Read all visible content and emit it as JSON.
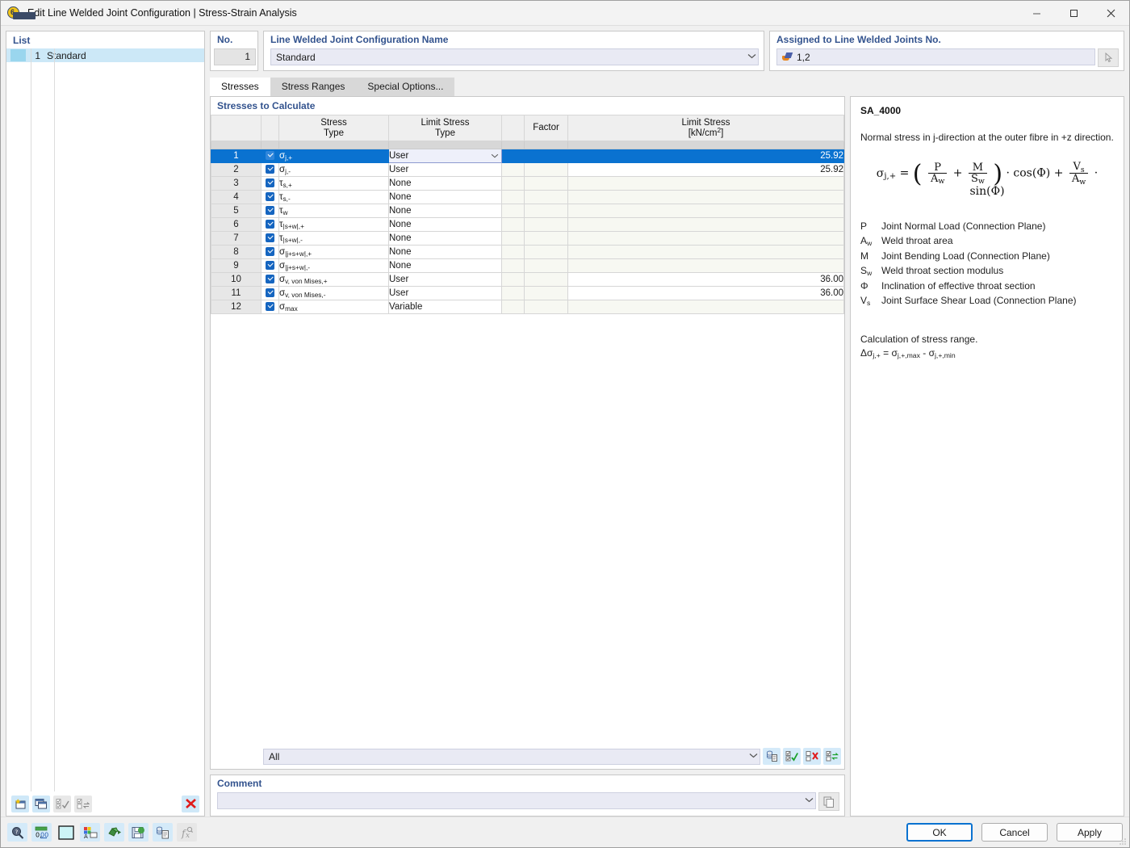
{
  "window": {
    "title": "Edit Line Welded Joint Configuration | Stress-Strain Analysis",
    "icon": "app-icon",
    "minimize": "—",
    "maximize": "□",
    "close": "✕"
  },
  "list_panel": {
    "header": "List",
    "rows": [
      {
        "number": "1",
        "name": "Standard"
      }
    ],
    "toolbar": [
      {
        "name": "new-item-button",
        "enabled": true
      },
      {
        "name": "copy-item-button",
        "enabled": true
      },
      {
        "name": "select-all-button",
        "enabled": false
      },
      {
        "name": "invert-selection-button",
        "enabled": false
      },
      {
        "name": "delete-item-button",
        "enabled": true
      }
    ]
  },
  "number_field": {
    "label": "No.",
    "value": "1"
  },
  "name_field": {
    "label": "Line Welded Joint Configuration Name",
    "value": "Standard"
  },
  "assigned_field": {
    "label": "Assigned to Line Welded Joints No.",
    "value": "1,2"
  },
  "tabs": [
    {
      "label": "Stresses",
      "active": true
    },
    {
      "label": "Stress Ranges",
      "active": false
    },
    {
      "label": "Special Options...",
      "active": false
    }
  ],
  "stress_table": {
    "title": "Stresses to Calculate",
    "columns": [
      {
        "key": "num",
        "header": ""
      },
      {
        "key": "chk",
        "header": ""
      },
      {
        "key": "stress_type",
        "header": "Stress\nType"
      },
      {
        "key": "limit_stress_type",
        "header": "Limit Stress\nType"
      },
      {
        "key": "gap",
        "header": ""
      },
      {
        "key": "factor",
        "header": "Factor"
      },
      {
        "key": "limit_stress",
        "header": "Limit Stress\n[kN/cm2]"
      }
    ],
    "header_stress_type_l1": "Stress",
    "header_stress_type_l2": "Type",
    "header_limit_type_l1": "Limit Stress",
    "header_limit_type_l2": "Type",
    "header_factor": "Factor",
    "header_limit_stress_l1": "Limit Stress",
    "header_limit_stress_l2_pre": "[kN/cm",
    "header_limit_stress_l2_sup": "2",
    "header_limit_stress_l2_post": "]",
    "rows": [
      {
        "num": "1",
        "checked": true,
        "stress_sym": "σ",
        "stress_sub": "j,+",
        "limit_type": "User",
        "factor": "",
        "limit_stress": "25.92",
        "selected": true
      },
      {
        "num": "2",
        "checked": true,
        "stress_sym": "σ",
        "stress_sub": "j,-",
        "limit_type": "User",
        "factor": "",
        "limit_stress": "25.92",
        "selected": false
      },
      {
        "num": "3",
        "checked": true,
        "stress_sym": "τ",
        "stress_sub": "s,+",
        "limit_type": "None",
        "factor": "",
        "limit_stress": "",
        "selected": false
      },
      {
        "num": "4",
        "checked": true,
        "stress_sym": "τ",
        "stress_sub": "s,-",
        "limit_type": "None",
        "factor": "",
        "limit_stress": "",
        "selected": false
      },
      {
        "num": "5",
        "checked": true,
        "stress_sym": "τ",
        "stress_sub": "w",
        "limit_type": "None",
        "factor": "",
        "limit_stress": "",
        "selected": false
      },
      {
        "num": "6",
        "checked": true,
        "stress_sym": "τ",
        "stress_sub": "|s+w|,+",
        "limit_type": "None",
        "factor": "",
        "limit_stress": "",
        "selected": false
      },
      {
        "num": "7",
        "checked": true,
        "stress_sym": "τ",
        "stress_sub": "|s+w|,-",
        "limit_type": "None",
        "factor": "",
        "limit_stress": "",
        "selected": false
      },
      {
        "num": "8",
        "checked": true,
        "stress_sym": "σ",
        "stress_sub": "|j+s+w|,+",
        "limit_type": "None",
        "factor": "",
        "limit_stress": "",
        "selected": false
      },
      {
        "num": "9",
        "checked": true,
        "stress_sym": "σ",
        "stress_sub": "|j+s+w|,-",
        "limit_type": "None",
        "factor": "",
        "limit_stress": "",
        "selected": false
      },
      {
        "num": "10",
        "checked": true,
        "stress_sym": "σ",
        "stress_sub": "v, von Mises,+",
        "limit_type": "User",
        "factor": "",
        "limit_stress": "36.00",
        "selected": false
      },
      {
        "num": "11",
        "checked": true,
        "stress_sym": "σ",
        "stress_sub": "v, von Mises,-",
        "limit_type": "User",
        "factor": "",
        "limit_stress": "36.00",
        "selected": false
      },
      {
        "num": "12",
        "checked": true,
        "stress_sym": "σ",
        "stress_sub": "max",
        "limit_type": "Variable",
        "factor": "",
        "limit_stress": "",
        "selected": false
      }
    ],
    "bottom": {
      "filter_value": "All",
      "buttons": [
        {
          "name": "insert-rows-button"
        },
        {
          "name": "check-all-button"
        },
        {
          "name": "uncheck-all-button"
        },
        {
          "name": "reset-button"
        }
      ]
    }
  },
  "comment": {
    "label": "Comment",
    "value": ""
  },
  "info_panel": {
    "code": "SA_4000",
    "description": "Normal stress in j-direction at the outer fibre in +z direction.",
    "formula": {
      "lhs_sym": "σ",
      "lhs_sub": "j,+",
      "eq": "=",
      "frac1_n": "P",
      "frac1_d_sym": "A",
      "frac1_d_sub": "w",
      "plus": "+",
      "frac2_n": "M",
      "frac2_d_sym": "S",
      "frac2_d_sub": "w",
      "cos": "· cos(Φ) +",
      "frac3_n_sym": "V",
      "frac3_n_sub": "s",
      "frac3_d_sym": "A",
      "frac3_d_sub": "w",
      "sin": "· sin(Φ)"
    },
    "symbols": [
      {
        "sym": "P",
        "sub": "",
        "desc": "Joint Normal Load (Connection Plane)"
      },
      {
        "sym": "A",
        "sub": "w",
        "desc": "Weld throat area"
      },
      {
        "sym": "M",
        "sub": "",
        "desc": "Joint Bending Load (Connection Plane)"
      },
      {
        "sym": "S",
        "sub": "w",
        "desc": "Weld throat section modulus"
      },
      {
        "sym": "Φ",
        "sub": "",
        "desc": "Inclination of effective throat section"
      },
      {
        "sym": "V",
        "sub": "s",
        "desc": "Joint Surface Shear Load (Connection Plane)"
      }
    ],
    "range_title": "Calculation of stress range.",
    "range_formula_delta": "Δσ",
    "range_formula_sub1": "j,+",
    "range_formula_eq": " = ",
    "range_formula_sym2": "σ",
    "range_formula_sub2": "j,+,max",
    "range_formula_minus": " - ",
    "range_formula_sym3": "σ",
    "range_formula_sub3": "j,+,min"
  },
  "bottom_bar": {
    "tools": [
      {
        "name": "info-search-icon",
        "enabled": true
      },
      {
        "name": "decimal-places-icon",
        "enabled": true
      },
      {
        "name": "color-swatch-icon",
        "enabled": true
      },
      {
        "name": "display-properties-icon",
        "enabled": true
      },
      {
        "name": "render-icon",
        "enabled": true
      },
      {
        "name": "save-as-icon",
        "enabled": true
      },
      {
        "name": "export-table-icon",
        "enabled": true
      },
      {
        "name": "formula-icon",
        "enabled": false
      }
    ],
    "ok": "OK",
    "cancel": "Cancel",
    "apply": "Apply"
  },
  "colors": {
    "selection_blue": "#0a72d0",
    "label_blue": "#33538e",
    "field_lavender": "#e9eaf4",
    "list_selection": "#cce8f7",
    "alt_row": "#f7f8f2"
  }
}
